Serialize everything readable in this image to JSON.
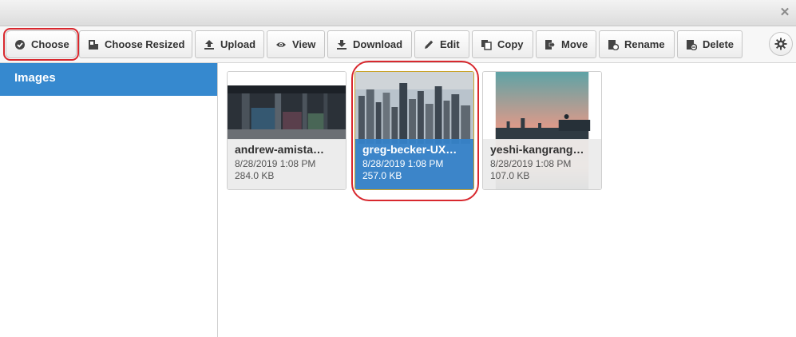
{
  "window": {
    "close_icon": "close-icon"
  },
  "toolbar": {
    "buttons": [
      {
        "label": "Choose",
        "icon": "check-circle-icon"
      },
      {
        "label": "Choose Resized",
        "icon": "crop-icon"
      },
      {
        "label": "Upload",
        "icon": "upload-icon"
      },
      {
        "label": "View",
        "icon": "eye-icon"
      },
      {
        "label": "Download",
        "icon": "download-icon"
      },
      {
        "label": "Edit",
        "icon": "pencil-icon"
      },
      {
        "label": "Copy",
        "icon": "copy-icon"
      },
      {
        "label": "Move",
        "icon": "move-icon"
      },
      {
        "label": "Rename",
        "icon": "rename-icon"
      },
      {
        "label": "Delete",
        "icon": "delete-icon"
      }
    ],
    "settings_icon": "gear-icon"
  },
  "sidebar": {
    "items": [
      {
        "label": "Images",
        "active": true
      }
    ]
  },
  "files": [
    {
      "name": "andrew-amista…",
      "date": "8/28/2019 1:08 PM",
      "size": "284.0 KB",
      "selected": false
    },
    {
      "name": "greg-becker-UX…",
      "date": "8/28/2019 1:08 PM",
      "size": "257.0 KB",
      "selected": true
    },
    {
      "name": "yeshi-kangrang…",
      "date": "8/28/2019 1:08 PM",
      "size": "107.0 KB",
      "selected": false
    }
  ],
  "colors": {
    "accent": "#3689cf",
    "highlight": "#d8282e"
  }
}
